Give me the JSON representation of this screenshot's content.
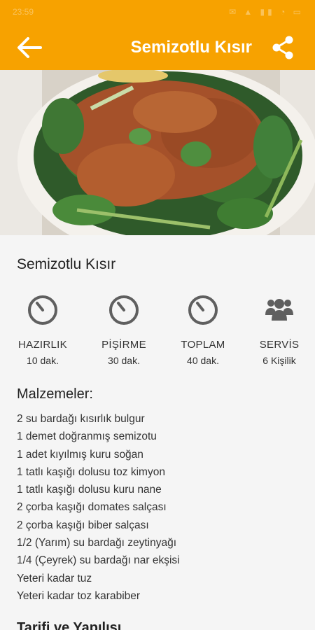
{
  "status_bar": {
    "time": "23:59",
    "icons": "✉ ▲ ▮▮ ◔ ▭"
  },
  "app_bar": {
    "title": "Semizotlu Kısır",
    "back_icon": "arrow-left-icon",
    "share_icon": "share-icon"
  },
  "hero_image": {
    "alt": "Semizotlu Kısır",
    "icon": "food-photo"
  },
  "recipe": {
    "title": "Semizotlu Kısır",
    "stats": [
      {
        "label": "HAZIRLIK",
        "value": "10 dak.",
        "icon": "timer-icon"
      },
      {
        "label": "PİŞİRME",
        "value": "30 dak.",
        "icon": "timer-icon"
      },
      {
        "label": "TOPLAM",
        "value": "40 dak.",
        "icon": "timer-icon"
      },
      {
        "label": "SERVİS",
        "value": "6 Kişilik",
        "icon": "people-icon"
      }
    ],
    "ingredients_title": "Malzemeler:",
    "ingredients": [
      "2 su bardağı kısırlık bulgur",
      "1 demet doğranmış semizotu",
      "1 adet kıyılmış kuru soğan",
      "1 tatlı kaşığı dolusu toz kimyon",
      "1 tatlı kaşığı dolusu kuru nane",
      "2 çorba kaşığı domates salçası",
      "2 çorba kaşığı biber salçası",
      "1/2 (Yarım) su bardağı zeytinyağı",
      "1/4 (Çeyrek) su bardağı nar ekşisi",
      "Yeteri kadar tuz",
      "Yeteri kadar toz karabiber"
    ],
    "next_section_title": "Tarifi ve Yapılışı"
  },
  "colors": {
    "accent": "#f7a200",
    "icon_gray": "#5f5f5f"
  }
}
